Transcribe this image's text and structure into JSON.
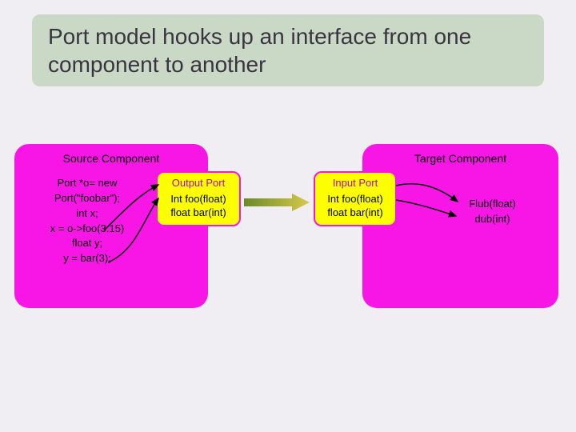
{
  "title": "Port model hooks up an interface from one component to another",
  "source": {
    "title": "Source Component",
    "code": "Port *o= new\nPort(\"foobar\");\nint x;\nx = o->foo(3.15)\nfloat y;\ny = bar(3);"
  },
  "target": {
    "title": "Target Component",
    "code": "Flub(float)\ndub(int)"
  },
  "output_port": {
    "label": "Output Port",
    "sig1": "Int foo(float)",
    "sig2": "float bar(int)"
  },
  "input_port": {
    "label": "Input Port",
    "sig1": "Int foo(float)",
    "sig2": "float bar(int)"
  }
}
